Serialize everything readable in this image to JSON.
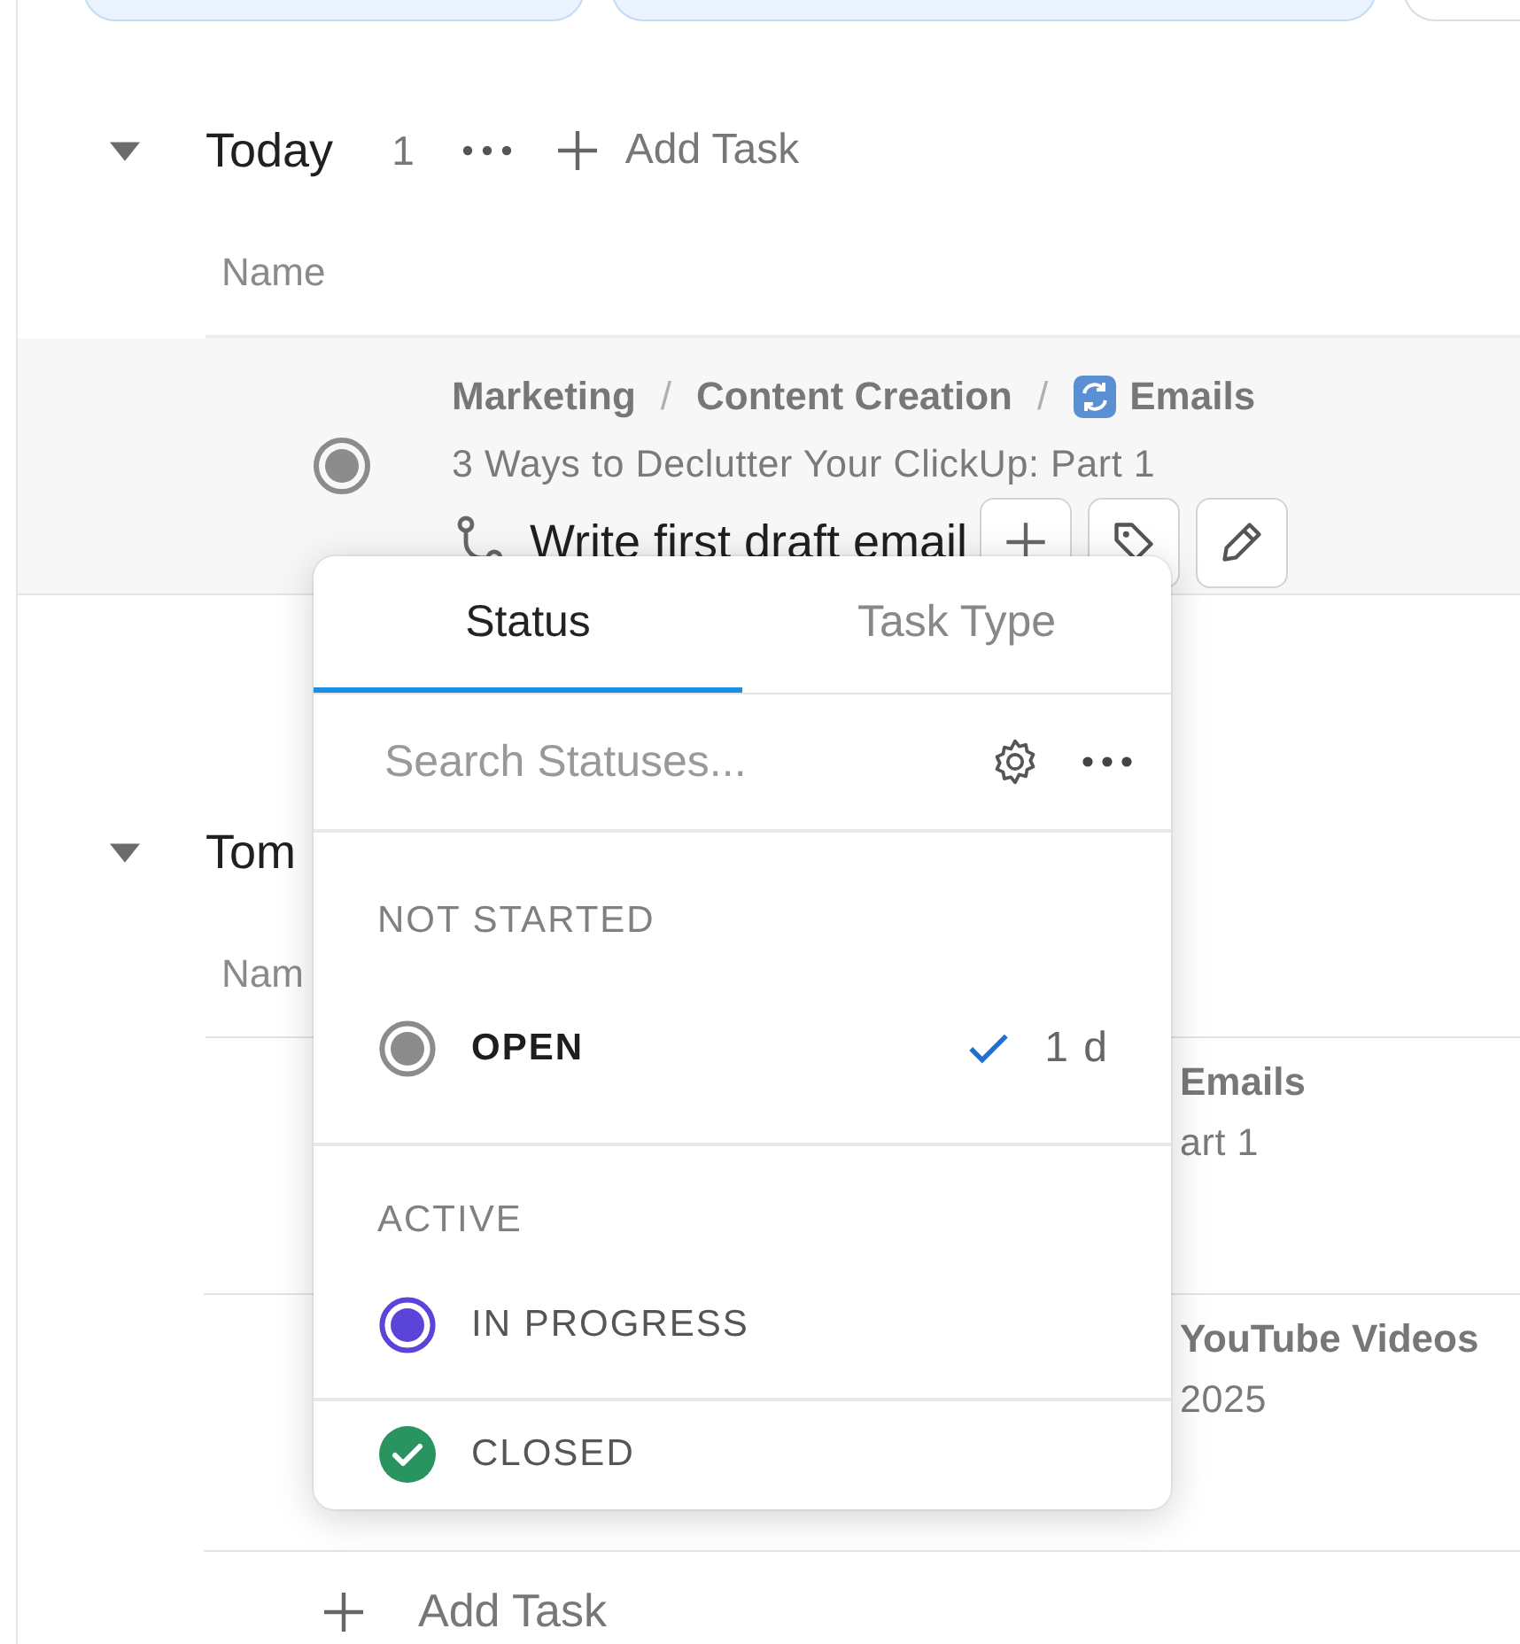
{
  "filter_chips": [
    {
      "selected": true
    },
    {
      "selected": true
    },
    {
      "selected": false
    }
  ],
  "today": {
    "title": "Today",
    "expanded": true,
    "count": "1",
    "add_label": "Add Task",
    "column": "Name",
    "tasks": [
      {
        "breadcrumb": [
          "Marketing",
          "Content Creation",
          "Emails"
        ],
        "parent": "3 Ways to Declutter Your ClickUp: Part 1",
        "name": "Write first draft email",
        "color": "#8c8c8c",
        "breadcrumb_separator": "/",
        "hovered": true
      }
    ]
  },
  "tomorrow": {
    "title": "Tom",
    "expanded": true,
    "column": "Nam",
    "tasks": [
      {
        "breadcrumb_tail": "Emails",
        "parent_tail": "art 1"
      },
      {
        "breadcrumb_tail": "YouTube Videos",
        "parent_tail": "2025"
      }
    ]
  },
  "add_task": "Add Task",
  "status_menu": {
    "tabs": [
      {
        "label": "Status",
        "selected": true
      },
      {
        "label": "Task Type",
        "selected": false
      }
    ],
    "search": {
      "placeholder": "Search Statuses..."
    },
    "groups": [
      {
        "label": "NOT STARTED",
        "statuses": [
          {
            "name": "OPEN",
            "kind": "todo",
            "color": "#8c8c8c",
            "selected": true,
            "duration": "1 d"
          }
        ]
      },
      {
        "label": "ACTIVE",
        "statuses": [
          {
            "name": "IN PROGRESS",
            "kind": "active",
            "color": "#5b45d9",
            "selected": false
          }
        ]
      },
      {
        "statuses": [
          {
            "name": "CLOSED",
            "kind": "done",
            "color": "#2a9461",
            "selected": false
          }
        ]
      }
    ]
  }
}
